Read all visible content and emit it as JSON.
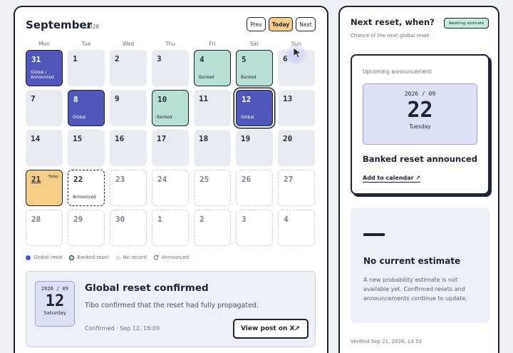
{
  "calendar": {
    "month": "September",
    "year": "2026",
    "nav": {
      "prev": "Prev",
      "today": "Today",
      "next": "Next"
    },
    "weekdays": [
      "Mon",
      "Tue",
      "Wed",
      "Thu",
      "Fri",
      "Sat",
      "Sun"
    ],
    "rows": [
      [
        {
          "num": "31",
          "label": "Global / Announced",
          "type": "global"
        },
        {
          "num": "1",
          "type": "plain"
        },
        {
          "num": "2",
          "type": "plain"
        },
        {
          "num": "3",
          "type": "plain"
        },
        {
          "num": "4",
          "label": "Banked",
          "type": "banked"
        },
        {
          "num": "5",
          "label": "Banked",
          "type": "banked"
        },
        {
          "num": "6",
          "type": "plain"
        }
      ],
      [
        {
          "num": "7",
          "type": "plain"
        },
        {
          "num": "8",
          "label": "Global",
          "type": "global"
        },
        {
          "num": "9",
          "type": "plain"
        },
        {
          "num": "10",
          "label": "Banked",
          "type": "banked"
        },
        {
          "num": "11",
          "type": "plain"
        },
        {
          "num": "12",
          "label": "Global",
          "type": "global selected"
        },
        {
          "num": "13",
          "type": "plain"
        }
      ],
      [
        {
          "num": "14",
          "type": "plain"
        },
        {
          "num": "15",
          "type": "plain"
        },
        {
          "num": "16",
          "type": "plain"
        },
        {
          "num": "17",
          "type": "plain"
        },
        {
          "num": "18",
          "type": "plain"
        },
        {
          "num": "19",
          "type": "plain"
        },
        {
          "num": "20",
          "type": "plain"
        }
      ],
      [
        {
          "num": "21",
          "badge": "Today",
          "type": "today"
        },
        {
          "num": "22",
          "label": "Announced",
          "type": "announced"
        },
        {
          "num": "23",
          "type": "norec"
        },
        {
          "num": "24",
          "type": "norec"
        },
        {
          "num": "25",
          "type": "norec"
        },
        {
          "num": "26",
          "type": "norec"
        },
        {
          "num": "27",
          "type": "norec"
        }
      ],
      [
        {
          "num": "28",
          "type": "norec"
        },
        {
          "num": "29",
          "type": "norec"
        },
        {
          "num": "30",
          "type": "norec"
        },
        {
          "num": "1",
          "type": "outside"
        },
        {
          "num": "2",
          "type": "outside"
        },
        {
          "num": "3",
          "type": "outside"
        },
        {
          "num": "4",
          "type": "outside"
        }
      ]
    ],
    "legend": {
      "global": "Global reset",
      "banked": "Banked reset",
      "norec": "No record",
      "announced": "Announced"
    }
  },
  "confirmation": {
    "date_ym": "2026 / 09",
    "date_day": "12",
    "weekday": "Saturday",
    "title": "Global reset confirmed",
    "description": "Tibo confirmed that the reset had fully propagated.",
    "meta": "Confirmed · Sep 12, 16:09",
    "button": "View post on X"
  },
  "sidebar": {
    "title": "Next reset, when?",
    "subtitle": "Chance of the next global reset",
    "badge": "Awaiting estimate",
    "announcement": {
      "label": "Upcoming announcement",
      "date_ym": "2026 / 09",
      "date_day": "22",
      "weekday": "Tuesday",
      "headline": "Banked reset announced",
      "link": "Add to calendar ↗"
    },
    "estimate": {
      "title": "No current estimate",
      "description": "A new probability estimate is not available yet. Confirmed resets and announcements continue to update."
    },
    "verified": "Verified Sep 21, 2026, 13:53"
  },
  "colors": {
    "global": "#5157ba",
    "banked": "#b8dfd4",
    "today": "#f5cd86",
    "ink": "#1e2333"
  }
}
